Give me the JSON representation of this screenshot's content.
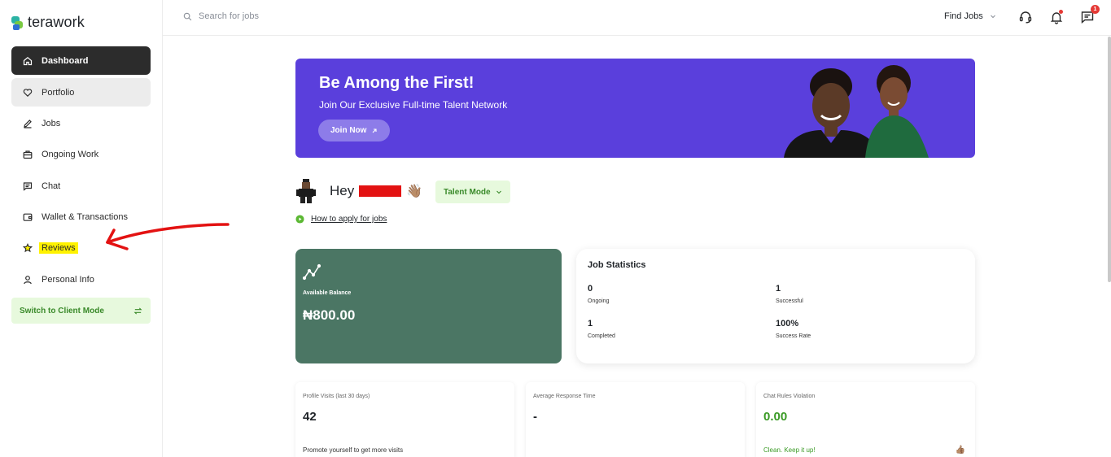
{
  "brand": {
    "name": "terawork"
  },
  "sidebar": {
    "items": [
      {
        "label": "Dashboard",
        "icon": "home-icon"
      },
      {
        "label": "Portfolio",
        "icon": "heart-icon"
      },
      {
        "label": "Jobs",
        "icon": "pen-icon"
      },
      {
        "label": "Ongoing Work",
        "icon": "briefcase-icon"
      },
      {
        "label": "Chat",
        "icon": "chat-icon"
      },
      {
        "label": "Wallet & Transactions",
        "icon": "wallet-icon"
      },
      {
        "label": "Reviews",
        "icon": "star-icon"
      },
      {
        "label": "Personal Info",
        "icon": "user-icon"
      }
    ],
    "switch_label": "Switch to Client Mode"
  },
  "topbar": {
    "search_placeholder": "Search for jobs",
    "find_jobs": "Find Jobs",
    "messages_badge": "1"
  },
  "banner": {
    "title": "Be Among the First!",
    "subtitle": "Join Our Exclusive Full-time Talent Network",
    "cta": "Join Now"
  },
  "greeting": {
    "hey": "Hey",
    "mode": "Talent Mode",
    "how_to": "How to apply for jobs"
  },
  "balance": {
    "label": "Available Balance",
    "amount": "₦800.00"
  },
  "job_stats": {
    "title": "Job Statistics",
    "items": [
      {
        "value": "0",
        "label": "Ongoing"
      },
      {
        "value": "1",
        "label": "Successful"
      },
      {
        "value": "1",
        "label": "Completed"
      },
      {
        "value": "100%",
        "label": "Success Rate"
      }
    ]
  },
  "cards": [
    {
      "title": "Profile Visits (last 30 days)",
      "value": "42",
      "footer": "Promote yourself to get more visits"
    },
    {
      "title": "Average Response Time",
      "value": "-",
      "footer": ""
    },
    {
      "title": "Chat Rules Violation",
      "value": "0.00",
      "footer": "Clean. Keep it up!"
    }
  ],
  "colors": {
    "banner": "#5a3fdc",
    "balance_card": "#4b7664",
    "active_nav": "#2c2c2c",
    "accent_green": "#3a8a2a",
    "highlight": "#fff200",
    "annotation": "#e31212"
  }
}
